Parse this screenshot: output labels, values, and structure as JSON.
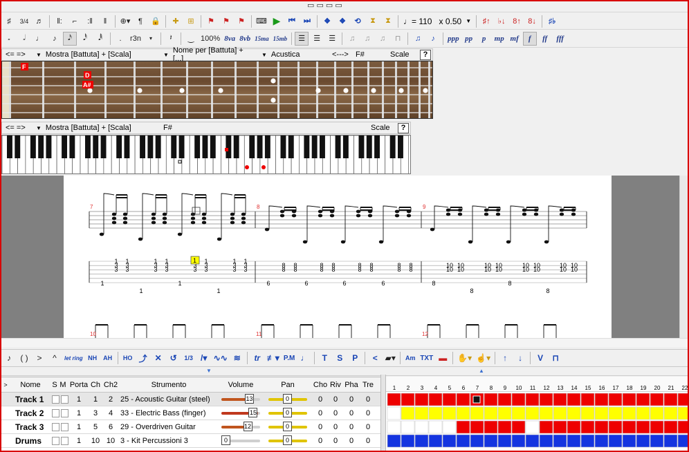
{
  "toolbar_edit": {
    "tempo": "= 110",
    "speed": "x 0.50"
  },
  "toolbar_notes": {
    "percent": "100%",
    "ottava_up": "8va",
    "ottava_down": "8vb",
    "quindicesima_up": "15ma",
    "quindicesima_down": "15mb",
    "tuplet_label": "r3n",
    "dynamics": [
      "ppp",
      "pp",
      "p",
      "mp",
      "mf",
      "f",
      "ff",
      "fff"
    ]
  },
  "fretboard_panel": {
    "nav": "<= =>",
    "view_mode": "Mostra [Battuta] + [Scala]",
    "name_mode": "Nome per [Battuta] + [...]",
    "tone": "Acustica",
    "arrows": "<--->",
    "key": "F#",
    "scale": "Scale",
    "help": "?",
    "note_labels": [
      "F",
      "D",
      "A#"
    ]
  },
  "piano_panel": {
    "nav": "<= =>",
    "view_mode": "Mostra [Battuta] + [Scala]",
    "key": "F#",
    "scale": "Scale",
    "help": "?"
  },
  "score": {
    "measures": [
      "7",
      "8",
      "9"
    ],
    "next_measures": [
      "10",
      "11",
      "12"
    ],
    "tab_measure7_top": [
      "1",
      "1",
      "1",
      "1",
      "1",
      "1",
      "1",
      "1"
    ],
    "tab_measure7_mid": [
      "3",
      "3",
      "3",
      "3",
      "3",
      "3",
      "3",
      "3"
    ],
    "tab_measure7_bass": [
      "1",
      "1",
      "1",
      "1"
    ],
    "tab_measure8_frets": [
      "8",
      "8"
    ],
    "tab_measure8_bass": [
      "6",
      "6",
      "6",
      "6"
    ],
    "tab_measure9_frets": [
      "10",
      "10"
    ],
    "tab_measure9_bass": [
      "8",
      "8",
      "8",
      "8"
    ],
    "cursor_value": "1"
  },
  "bottom_toolbar": {
    "let_ring": "let ring",
    "natural_harmonic": "NH",
    "artificial_harmonic": "AH",
    "hammer": "HO",
    "tr": "tr",
    "pm": "P.M",
    "tap": "T",
    "slap": "S",
    "pop": "P",
    "chord_label": "Am",
    "txt": "TXT",
    "vchar": "V"
  },
  "track_panel": {
    "headers": {
      "name": "Nome",
      "s": "S",
      "m": "M",
      "port": "Porta",
      "ch": "Ch",
      "ch2": "Ch2",
      "instrument": "Strumento",
      "volume": "Volume",
      "pan": "Pan",
      "cho": "Cho",
      "riv": "Riv",
      "pha": "Pha",
      "tre": "Tre"
    },
    "tracks": [
      {
        "name": "Track 1",
        "port": "1",
        "ch": "1",
        "ch2": "2",
        "instrument": "25 - Acoustic Guitar (steel)",
        "volume": "13",
        "pan": "0",
        "cho": "0",
        "riv": "0",
        "pha": "0",
        "tre": "0",
        "vol_fraction": 0.81,
        "vol_color": "#c0551e"
      },
      {
        "name": "Track 2",
        "port": "1",
        "ch": "3",
        "ch2": "4",
        "instrument": "33 - Electric Bass (finger)",
        "volume": "15",
        "pan": "0",
        "cho": "0",
        "riv": "0",
        "pha": "0",
        "tre": "0",
        "vol_fraction": 0.94,
        "vol_color": "#c0381e"
      },
      {
        "name": "Track 3",
        "port": "1",
        "ch": "5",
        "ch2": "6",
        "instrument": "29 - Overdriven Guitar",
        "volume": "12",
        "pan": "0",
        "cho": "0",
        "riv": "0",
        "pha": "0",
        "tre": "0",
        "vol_fraction": 0.75,
        "vol_color": "#c0551e"
      },
      {
        "name": "Drums",
        "port": "1",
        "ch": "10",
        "ch2": "10",
        "instrument": "3 - Kit Percussioni 3",
        "volume": "0",
        "pan": "0",
        "cho": "0",
        "riv": "0",
        "pha": "0",
        "tre": "0",
        "vol_fraction": 0.0,
        "vol_color": "#2aa82a"
      }
    ]
  },
  "measure_grid": {
    "numbers": [
      "1",
      "2",
      "3",
      "4",
      "5",
      "6",
      "7",
      "8",
      "9",
      "10",
      "11",
      "12",
      "13",
      "14",
      "15",
      "16",
      "17",
      "18",
      "19",
      "20",
      "21",
      "22"
    ],
    "colors": {
      "track1": "#ee0000",
      "track2": "#ffff00",
      "track3": "#ee0000",
      "drums": "#1434e0",
      "empty": "#ffffff"
    },
    "track3_filled_from": 5,
    "track3_gap_at": 10,
    "track2_empty_at": 0,
    "current_measure": 7
  }
}
